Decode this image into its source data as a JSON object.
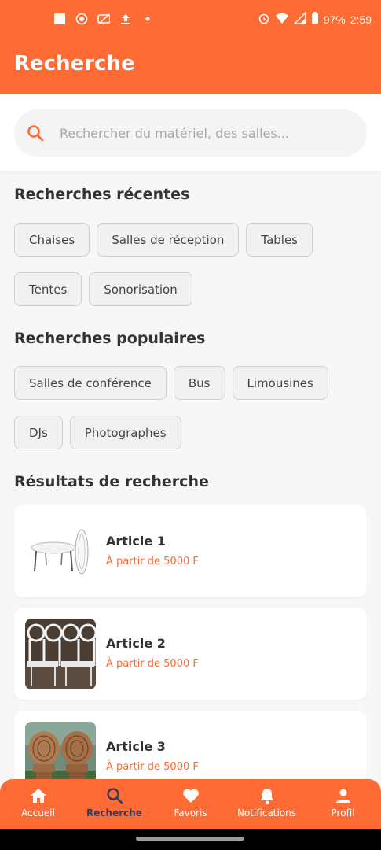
{
  "status_bar": {
    "battery": "97%",
    "time": "2:59"
  },
  "app_bar": {
    "title": "Recherche"
  },
  "search": {
    "placeholder": "Rechercher du matériel, des salles..."
  },
  "recent": {
    "title": "Recherches récentes",
    "chips": [
      "Chaises",
      "Salles de réception",
      "Tables",
      "Tentes",
      "Sonorisation"
    ]
  },
  "popular": {
    "title": "Recherches populaires",
    "chips": [
      "Salles de conférence",
      "Bus",
      "Limousines",
      "DJs",
      "Photographes"
    ]
  },
  "results": {
    "title": "Résultats de recherche",
    "items": [
      {
        "title": "Article 1",
        "price": "À partir de 5000 F",
        "image": "round-table-image"
      },
      {
        "title": "Article 2",
        "price": "À partir de 5000 F",
        "image": "white-chairs-image"
      },
      {
        "title": "Article 3",
        "price": "À partir de 5000 F",
        "image": "rattan-chairs-image"
      }
    ]
  },
  "bottom_nav": {
    "items": [
      {
        "label": "Accueil",
        "icon": "home-icon"
      },
      {
        "label": "Recherche",
        "icon": "search-icon",
        "active": true
      },
      {
        "label": "Favoris",
        "icon": "heart-icon"
      },
      {
        "label": "Notifications",
        "icon": "bell-icon"
      },
      {
        "label": "Profil",
        "icon": "person-icon"
      }
    ]
  },
  "colors": {
    "accent": "#ff6b35",
    "active_nav": "#3a3a5c"
  }
}
